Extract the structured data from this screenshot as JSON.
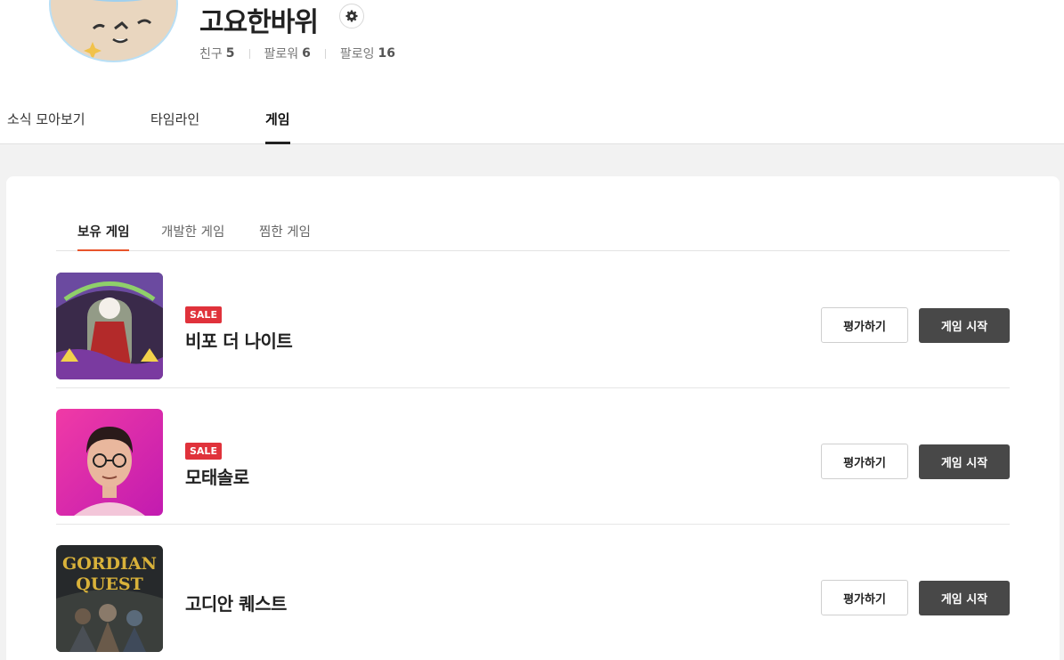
{
  "profile": {
    "name": "고요한바위",
    "settings_icon": "gear-icon",
    "stats": [
      {
        "label": "친구",
        "value": "5"
      },
      {
        "label": "팔로워",
        "value": "6"
      },
      {
        "label": "팔로잉",
        "value": "16"
      }
    ]
  },
  "main_tabs": [
    {
      "label": "소식 모아보기",
      "active": false
    },
    {
      "label": "타임라인",
      "active": false
    },
    {
      "label": "게임",
      "active": true
    }
  ],
  "sub_tabs": [
    {
      "label": "보유 게임",
      "active": true
    },
    {
      "label": "개발한 게임",
      "active": false
    },
    {
      "label": "찜한 게임",
      "active": false
    }
  ],
  "games": [
    {
      "title": "비포 더 나이트",
      "sale_badge": "SALE",
      "rate_label": "평가하기",
      "play_label": "게임 시작"
    },
    {
      "title": "모태솔로",
      "sale_badge": "SALE",
      "rate_label": "평가하기",
      "play_label": "게임 시작"
    },
    {
      "title": "고디안 퀘스트",
      "rate_label": "평가하기",
      "play_label": "게임 시작",
      "thumb_text": [
        "GORDIAN",
        "QUEST"
      ]
    }
  ],
  "colors": {
    "accent": "#e8542b",
    "sale": "#e0323b",
    "play_button": "#484848",
    "page_bg": "#f2f2f2"
  }
}
